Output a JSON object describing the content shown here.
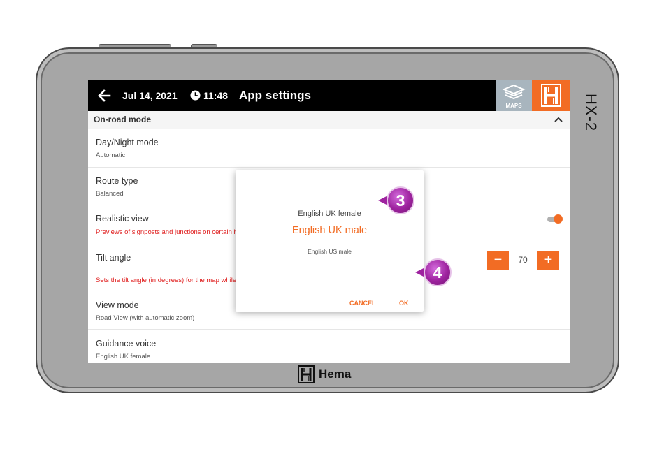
{
  "device": {
    "model": "HX-2",
    "brand": "Hema"
  },
  "topbar": {
    "date": "Jul 14, 2021",
    "time": "11:48",
    "title": "App settings",
    "maps_label": "MAPS"
  },
  "section": {
    "title": "On-road mode"
  },
  "rows": [
    {
      "title": "Day/Night mode",
      "subtitle": "Automatic"
    },
    {
      "title": "Route type",
      "subtitle": "Balanced"
    },
    {
      "title": "Realistic view",
      "subtitle": "Previews of signposts and junctions on certain h",
      "toggle_on": true
    },
    {
      "title": "Tilt angle",
      "subtitle": "Sets the tilt angle (in degrees) for the map while driving. Set to zero for flat map",
      "value": "70"
    },
    {
      "title": "View mode",
      "subtitle": "Road View (with automatic zoom)"
    },
    {
      "title": "Guidance voice",
      "subtitle": "English UK female"
    }
  ],
  "stepper": {
    "minus_label": "−",
    "plus_label": "+",
    "value": "70"
  },
  "dialog": {
    "options": [
      "English UK female",
      "English UK male",
      "English US male"
    ],
    "selected": "English UK male",
    "cancel_label": "CANCEL",
    "ok_label": "OK"
  },
  "callouts": [
    "3",
    "4"
  ],
  "colors": {
    "accent": "#f26c24",
    "callout": "#9e239f",
    "topbar": "#000000",
    "warning_text": "#e02020"
  },
  "icons": [
    "back-arrow-icon",
    "clock-icon",
    "layers-icon",
    "hema-logo-icon",
    "chevron-up-icon"
  ]
}
